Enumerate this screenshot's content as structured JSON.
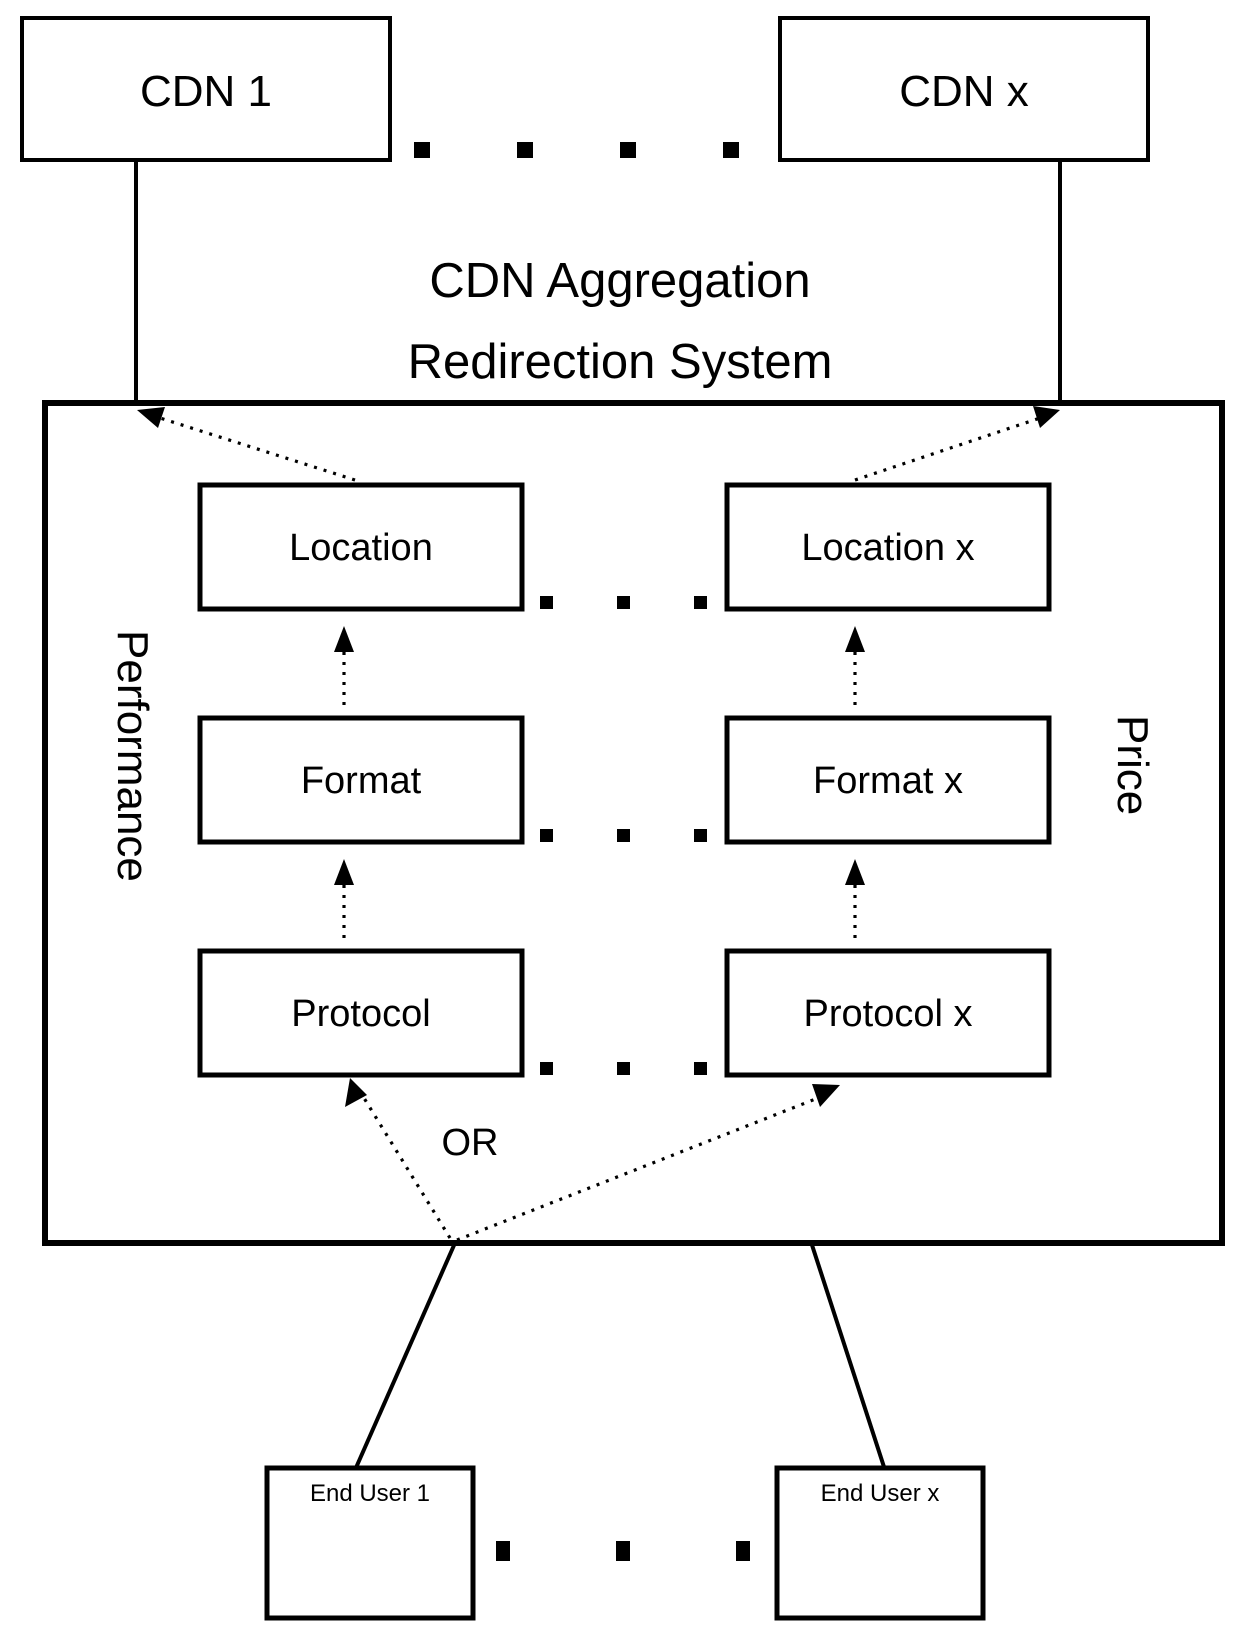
{
  "diagram": {
    "title_line1": "CDN Aggregation",
    "title_line2": "Redirection System",
    "side_labels": {
      "left": "Performance",
      "right": "Price"
    },
    "or_label": "OR",
    "cdn_nodes": [
      {
        "id": "cdn-1",
        "label": "CDN 1"
      },
      {
        "id": "cdn-x",
        "label": "CDN x"
      }
    ],
    "criteria_rows": [
      {
        "row": "location",
        "left_label": "Location",
        "right_label": "Location x"
      },
      {
        "row": "format",
        "left_label": "Format",
        "right_label": "Format  x"
      },
      {
        "row": "protocol",
        "left_label": "Protocol",
        "right_label": "Protocol x"
      }
    ],
    "end_users": [
      {
        "id": "end-user-1",
        "label": "End User 1"
      },
      {
        "id": "end-user-x",
        "label": "End User x"
      }
    ],
    "colors": {
      "stroke": "#000000",
      "fill": "#ffffff",
      "background": "#ffffff"
    }
  }
}
